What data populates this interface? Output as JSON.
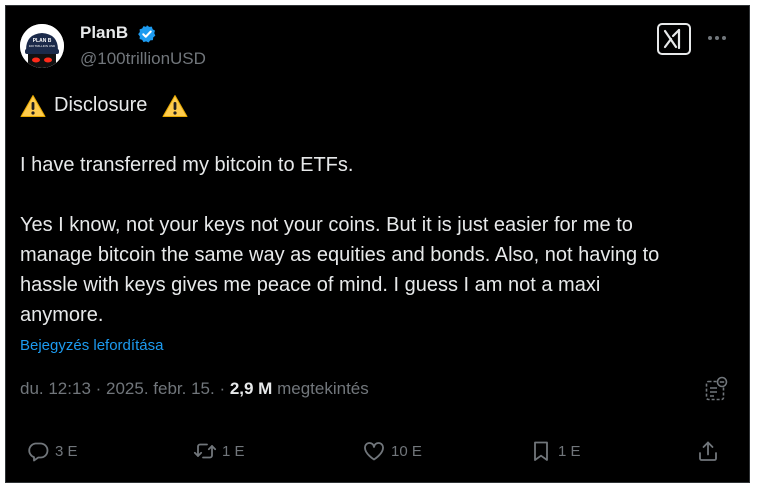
{
  "author": {
    "display_name": "PlanB",
    "handle": "@100trillionUSD",
    "avatar_caption": "PLAN B\n100 TRILLION USD"
  },
  "tweet": {
    "lines": [
      "Disclosure",
      "I have transferred my bitcoin to ETFs.",
      "Yes I know, not your keys not your coins. But it is just easier for me to",
      "manage bitcoin the same way as equities and bonds. Also, not having to",
      "hassle with keys gives me peace of mind. I guess I am not a maxi",
      "anymore."
    ],
    "translate_label": "Bejegyzés lefordítása"
  },
  "meta": {
    "time": "du. 12:13",
    "date": "2025. febr. 15.",
    "views": "2,9 M",
    "views_label": "megtekintés"
  },
  "actions": {
    "replies": "3 E",
    "reposts": "1 E",
    "likes": "10 E",
    "bookmarks": "1 E"
  },
  "colors": {
    "background": "#000000",
    "text": "#e7e9ea",
    "secondary": "#71767b",
    "link": "#1d9bf0",
    "verified": "#1d9bf0"
  }
}
